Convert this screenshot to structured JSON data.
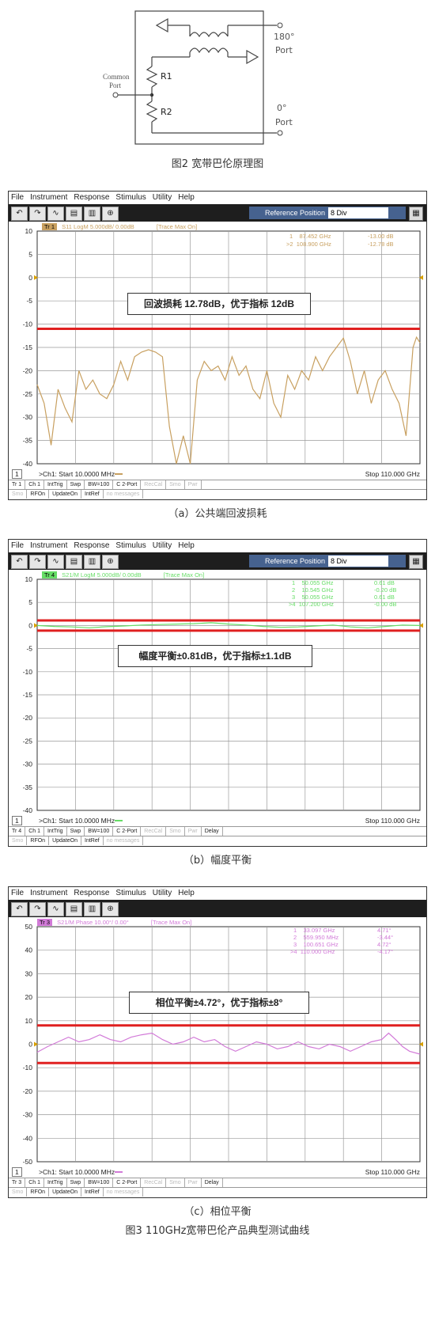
{
  "schematic": {
    "ports": {
      "p180": "180°",
      "port_word": "Port",
      "p0": "0°",
      "common": "Common",
      "common_port": "Port"
    },
    "resistors": {
      "r1": "R1",
      "r2": "R2"
    },
    "caption": "图2 宽带巴伦原理图"
  },
  "menu": [
    "File",
    "Instrument",
    "Response",
    "Stimulus",
    "Utility",
    "Help"
  ],
  "toolbar_icons": [
    "undo-icon",
    "redo-icon",
    "trace-icon",
    "display-icon",
    "delete-icon",
    "zoom-icon"
  ],
  "ref_position": {
    "label": "Reference Position",
    "value": "8 Div"
  },
  "panels": [
    {
      "id": "a",
      "trace_tag": "Tr 1",
      "trace_info": "S11 LogM 5.000dB/ 0.00dB",
      "trace_max": "[Trace Max On]",
      "trace_color": "#c8a060",
      "markers": [
        {
          "idx": "1",
          "freq": "87.452 GHz",
          "val": "-13.00 dB"
        },
        {
          "idx": "2",
          "freq": "108.900 GHz",
          "val": "-12.78 dB"
        }
      ],
      "annotation": "回波损耗 12.78dB，优于指标 12dB",
      "y_ticks": [
        "10",
        "5",
        "0",
        "-5",
        "-10",
        "-15",
        "-20",
        "-25",
        "-30",
        "-35",
        "-40"
      ],
      "start": ">Ch1: Start  10.0000 MHz",
      "stop": "Stop  110.000 GHz",
      "page": "1",
      "softkeys1": [
        "Tr 1",
        "Ch 1",
        "IntTrig",
        "Swp",
        "BW=100",
        "C  2-Port",
        "RecCal",
        "Smo",
        "Pwr",
        ""
      ],
      "softkeys2": [
        "Smo",
        "RFOn",
        "UpdateOn",
        "IntRef",
        "no messages"
      ],
      "caption": "（a）公共端回波损耗"
    },
    {
      "id": "b",
      "trace_tag": "Tr 4",
      "trace_info": "S21/M LogM 5.000dB/ 0.00dB",
      "trace_max": "[Trace Max On]",
      "trace_color": "#66dd66",
      "markers": [
        {
          "idx": "1",
          "freq": "50.055 GHz",
          "val": "0.61 dB"
        },
        {
          "idx": "2",
          "freq": "10.545 GHz",
          "val": "-0.20 dB"
        },
        {
          "idx": "3",
          "freq": "50.055 GHz",
          "val": "0.61 dB"
        },
        {
          "idx": "4",
          "freq": "107.200 GHz",
          "val": "-0.00 dB"
        }
      ],
      "annotation": "幅度平衡±0.81dB，优于指标±1.1dB",
      "y_ticks": [
        "10",
        "5",
        "0",
        "-5",
        "-10",
        "-15",
        "-20",
        "-25",
        "-30",
        "-35",
        "-40"
      ],
      "start": ">Ch1: Start  10.0000 MHz",
      "stop": "Stop  110.000 GHz",
      "page": "1",
      "softkeys1": [
        "Tr 4",
        "Ch 1",
        "IntTrig",
        "Swp",
        "BW=100",
        "C  2-Port",
        "RecCal",
        "Smo",
        "Pwr",
        "Delay"
      ],
      "softkeys2": [
        "Smo",
        "RFOn",
        "UpdateOn",
        "IntRef",
        "no messages"
      ],
      "caption": "（b）幅度平衡"
    },
    {
      "id": "c",
      "trace_tag": "Tr 3",
      "trace_info": "S21/M Phase 10.00°/ 0.00°",
      "trace_max": "[Trace Max On]",
      "trace_color": "#d27ad8",
      "markers": [
        {
          "idx": "1",
          "freq": "33.097 GHz",
          "val": "4.71°"
        },
        {
          "idx": "2",
          "freq": "559.950 MHz",
          "val": "-3.44°"
        },
        {
          "idx": "3",
          "freq": "100.651 GHz",
          "val": "4.72°"
        },
        {
          "idx": "4",
          "freq": "110.000 GHz",
          "val": "-4.17°"
        }
      ],
      "annotation": "相位平衡±4.72°，优于指标±8°",
      "y_ticks": [
        "50",
        "40",
        "30",
        "20",
        "10",
        "0",
        "-10",
        "-20",
        "-30",
        "-40",
        "-50"
      ],
      "start": ">Ch1: Start  10.0000 MHz",
      "stop": "Stop  110.000 GHz",
      "page": "1",
      "softkeys1": [
        "Tr 3",
        "Ch 1",
        "IntTrig",
        "Swp",
        "BW=100",
        "C  2-Port",
        "RecCal",
        "Smo",
        "Pwr",
        "Delay"
      ],
      "softkeys2": [
        "Smo",
        "RFOn",
        "UpdateOn",
        "IntRef",
        "no messages"
      ],
      "caption": "（c）相位平衡"
    }
  ],
  "chart_data": [
    {
      "type": "line",
      "xlabel": "",
      "ylabel": "",
      "xlim": [
        0.01,
        110
      ],
      "ylim": [
        -40,
        10
      ],
      "limit_lines": [
        -11
      ],
      "series": [
        {
          "values": [
            [
              0.01,
              -23
            ],
            [
              2,
              -27
            ],
            [
              4,
              -36
            ],
            [
              6,
              -24
            ],
            [
              8,
              -28
            ],
            [
              10,
              -31
            ],
            [
              12,
              -20
            ],
            [
              14,
              -24
            ],
            [
              16,
              -22
            ],
            [
              18,
              -25
            ],
            [
              20,
              -26
            ],
            [
              22,
              -23
            ],
            [
              24,
              -18
            ],
            [
              26,
              -22
            ],
            [
              28,
              -17
            ],
            [
              30,
              -16
            ],
            [
              32,
              -15.5
            ],
            [
              34,
              -16
            ],
            [
              36,
              -17
            ],
            [
              38,
              -32
            ],
            [
              40,
              -41
            ],
            [
              42,
              -34
            ],
            [
              44,
              -40
            ],
            [
              46,
              -22
            ],
            [
              48,
              -18
            ],
            [
              50,
              -20
            ],
            [
              52,
              -19
            ],
            [
              54,
              -22
            ],
            [
              56,
              -17
            ],
            [
              58,
              -21
            ],
            [
              60,
              -19
            ],
            [
              62,
              -24
            ],
            [
              64,
              -26
            ],
            [
              66,
              -20
            ],
            [
              68,
              -27
            ],
            [
              70,
              -30
            ],
            [
              72,
              -21
            ],
            [
              74,
              -24
            ],
            [
              76,
              -20
            ],
            [
              78,
              -22
            ],
            [
              80,
              -17
            ],
            [
              82,
              -20
            ],
            [
              84,
              -17
            ],
            [
              86,
              -15
            ],
            [
              88,
              -13
            ],
            [
              90,
              -18
            ],
            [
              92,
              -25
            ],
            [
              94,
              -20
            ],
            [
              96,
              -27
            ],
            [
              98,
              -22
            ],
            [
              100,
              -20
            ],
            [
              102,
              -24
            ],
            [
              104,
              -27
            ],
            [
              106,
              -34
            ],
            [
              108,
              -15
            ],
            [
              109,
              -12.8
            ],
            [
              110,
              -14
            ]
          ]
        }
      ]
    },
    {
      "type": "line",
      "xlabel": "",
      "ylabel": "",
      "xlim": [
        0.01,
        110
      ],
      "ylim": [
        -40,
        10
      ],
      "limit_lines": [
        1.1,
        -1.1
      ],
      "series": [
        {
          "values": [
            [
              0.01,
              0
            ],
            [
              5,
              -0.2
            ],
            [
              10,
              -0.3
            ],
            [
              15,
              -0.5
            ],
            [
              20,
              -0.25
            ],
            [
              25,
              -0.1
            ],
            [
              30,
              0.1
            ],
            [
              35,
              0.2
            ],
            [
              40,
              0.3
            ],
            [
              45,
              0.4
            ],
            [
              50,
              0.6
            ],
            [
              55,
              0.3
            ],
            [
              60,
              0.1
            ],
            [
              65,
              -0.2
            ],
            [
              70,
              -0.4
            ],
            [
              75,
              -0.3
            ],
            [
              80,
              -0.1
            ],
            [
              85,
              0.1
            ],
            [
              90,
              -0.3
            ],
            [
              95,
              -0.5
            ],
            [
              100,
              -0.2
            ],
            [
              105,
              0.1
            ],
            [
              110,
              0
            ]
          ]
        }
      ]
    },
    {
      "type": "line",
      "xlabel": "",
      "ylabel": "",
      "xlim": [
        0.01,
        110
      ],
      "ylim": [
        -50,
        50
      ],
      "limit_lines": [
        8,
        -8
      ],
      "series": [
        {
          "values": [
            [
              0.01,
              -3.4
            ],
            [
              3,
              -1
            ],
            [
              6,
              1
            ],
            [
              9,
              3
            ],
            [
              12,
              1
            ],
            [
              15,
              2
            ],
            [
              18,
              4
            ],
            [
              21,
              2
            ],
            [
              24,
              1
            ],
            [
              27,
              3
            ],
            [
              30,
              4
            ],
            [
              33,
              4.7
            ],
            [
              36,
              2
            ],
            [
              39,
              0
            ],
            [
              42,
              1
            ],
            [
              45,
              3
            ],
            [
              48,
              1
            ],
            [
              51,
              2
            ],
            [
              54,
              -1
            ],
            [
              57,
              -3
            ],
            [
              60,
              -1
            ],
            [
              63,
              1
            ],
            [
              66,
              0
            ],
            [
              69,
              -2
            ],
            [
              72,
              -1
            ],
            [
              75,
              1
            ],
            [
              78,
              -1
            ],
            [
              81,
              -2
            ],
            [
              84,
              0
            ],
            [
              87,
              -1
            ],
            [
              90,
              -3
            ],
            [
              93,
              -1
            ],
            [
              96,
              1
            ],
            [
              99,
              2
            ],
            [
              101,
              4.7
            ],
            [
              103,
              2
            ],
            [
              105,
              -1
            ],
            [
              107,
              -3
            ],
            [
              110,
              -4.2
            ]
          ]
        }
      ]
    }
  ],
  "figure_caption": "图3 110GHz宽带巴伦产品典型测试曲线"
}
